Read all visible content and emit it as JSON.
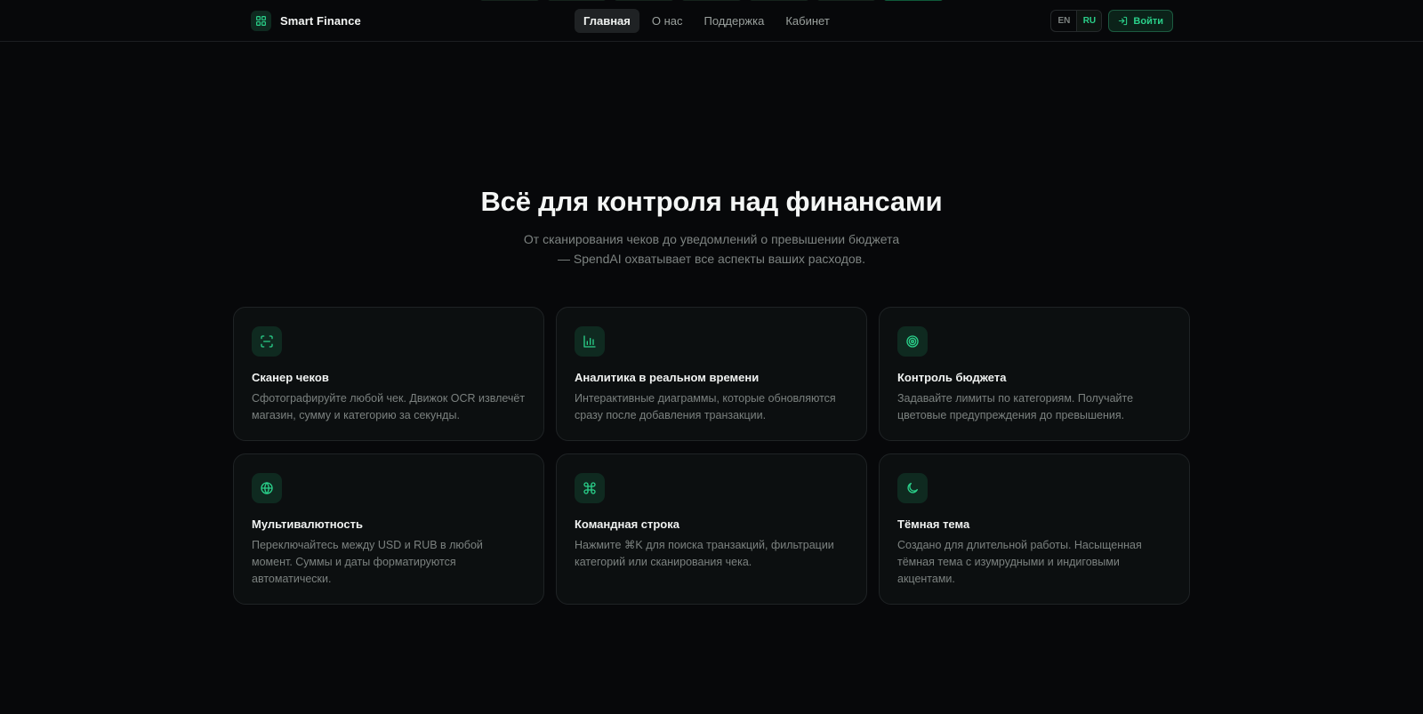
{
  "header": {
    "brand": "Smart Finance",
    "nav": [
      "Главная",
      "О нас",
      "Поддержка",
      "Кабинет"
    ],
    "active_nav": "Главная",
    "lang": {
      "en": "EN",
      "ru": "RU",
      "selected": "RU"
    },
    "login_label": "Войти"
  },
  "hero": {
    "title": "Всё для контроля над финансами",
    "subtitle": "От сканирования чеков до уведомлений о превышении бюджета — SpendAI охватывает все аспекты ваших расходов."
  },
  "features": [
    {
      "icon": "scan-icon",
      "title": "Сканер чеков",
      "text": "Сфотографируйте любой чек. Движок OCR извлечёт магазин, сумму и категорию за секунды."
    },
    {
      "icon": "bar-chart-icon",
      "title": "Аналитика в реальном времени",
      "text": "Интерактивные диаграммы, которые обновляются сразу после добавления транзакции."
    },
    {
      "icon": "target-icon",
      "title": "Контроль бюджета",
      "text": "Задавайте лимиты по категориям. Получайте цветовые предупреждения до превышения."
    },
    {
      "icon": "globe-icon",
      "title": "Мультивалютность",
      "text": "Переключайтесь между USD и RUB в любой момент. Суммы и даты форматируются автоматически."
    },
    {
      "icon": "command-icon",
      "title": "Командная строка",
      "text": "Нажмите ⌘K для поиска транзакций, фильтрации категорий или сканирования чека."
    },
    {
      "icon": "moon-icon",
      "title": "Тёмная тема",
      "text": "Создано для длительной работы. Насыщенная тёмная тема с изумрудными и индиговыми акцентами."
    }
  ],
  "colors": {
    "accent": "#2ad08a",
    "background": "#07080a",
    "card": "#0c0f10"
  }
}
